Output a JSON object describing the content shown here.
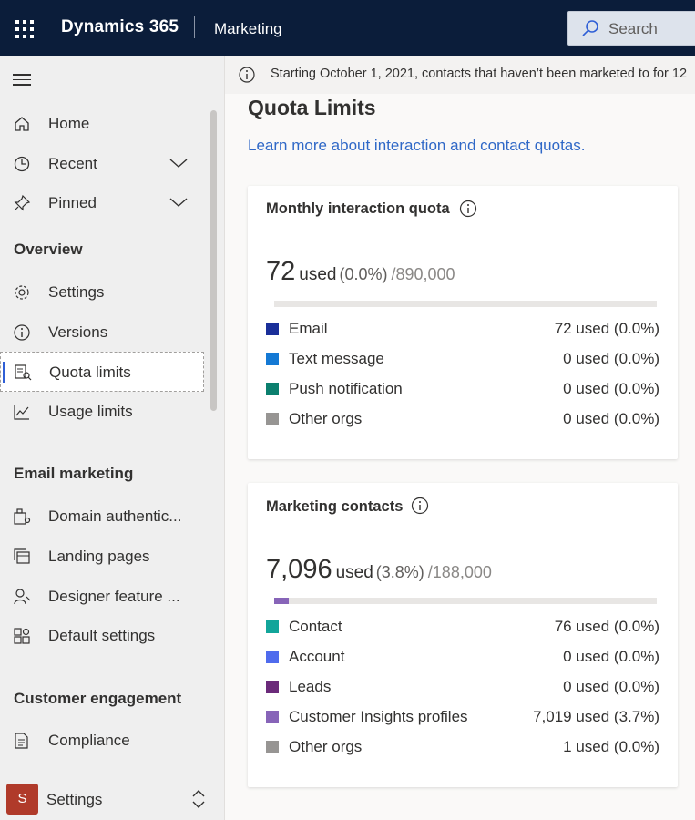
{
  "topbar": {
    "brand": "Dynamics 365",
    "app": "Marketing",
    "search_placeholder": "Search"
  },
  "sidebar": {
    "nav": [
      {
        "label": "Home",
        "icon": "home-icon"
      },
      {
        "label": "Recent",
        "icon": "clock-icon",
        "expandable": true
      },
      {
        "label": "Pinned",
        "icon": "pin-icon",
        "expandable": true
      }
    ],
    "sections": [
      {
        "title": "Overview",
        "items": [
          {
            "label": "Settings",
            "icon": "gear-icon"
          },
          {
            "label": "Versions",
            "icon": "info-icon"
          },
          {
            "label": "Quota limits",
            "icon": "quota-icon",
            "selected": true
          },
          {
            "label": "Usage limits",
            "icon": "chart-icon"
          }
        ]
      },
      {
        "title": "Email marketing",
        "items": [
          {
            "label": "Domain authentic...",
            "icon": "domain-icon"
          },
          {
            "label": "Landing pages",
            "icon": "pages-icon"
          },
          {
            "label": "Designer feature ...",
            "icon": "designer-icon"
          },
          {
            "label": "Default settings",
            "icon": "settings-grid-icon"
          }
        ]
      },
      {
        "title": "Customer engagement",
        "items": [
          {
            "label": "Compliance",
            "icon": "document-icon"
          }
        ]
      }
    ],
    "footer": {
      "avatar_letter": "S",
      "label": "Settings"
    }
  },
  "notice": {
    "text": "Starting October 1, 2021, contacts that haven’t been marketed to for 12"
  },
  "main": {
    "title": "Quota Limits",
    "learn_more": "Learn more about interaction and contact quotas."
  },
  "cards": [
    {
      "title": "Monthly interaction quota",
      "used_value": "72",
      "used_word": "used",
      "percent": "(0.0%)",
      "total": "/890,000",
      "fill_fraction": 0.0,
      "fill_color": "#1a2f99",
      "rows": [
        {
          "label": "Email",
          "value": "72 used (0.0%)",
          "color": "#1a2f99"
        },
        {
          "label": "Text message",
          "value": "0 used (0.0%)",
          "color": "#1479d4"
        },
        {
          "label": "Push notification",
          "value": "0 used (0.0%)",
          "color": "#0b7f6e"
        },
        {
          "label": "Other orgs",
          "value": "0 used (0.0%)",
          "color": "#979593"
        }
      ]
    },
    {
      "title": "Marketing contacts",
      "used_value": "7,096",
      "used_word": "used",
      "percent": "(3.8%)",
      "total": "/188,000",
      "fill_fraction": 0.038,
      "fill_color": "#8764b8",
      "rows": [
        {
          "label": "Contact",
          "value": "76 used (0.0%)",
          "color": "#12a59a"
        },
        {
          "label": "Account",
          "value": "0 used (0.0%)",
          "color": "#4f6bed"
        },
        {
          "label": "Leads",
          "value": "0 used (0.0%)",
          "color": "#6b2a7a"
        },
        {
          "label": "Customer Insights profiles",
          "value": "7,019 used (3.7%)",
          "color": "#8764b8"
        },
        {
          "label": "Other orgs",
          "value": "1 used (0.0%)",
          "color": "#979593"
        }
      ]
    }
  ]
}
